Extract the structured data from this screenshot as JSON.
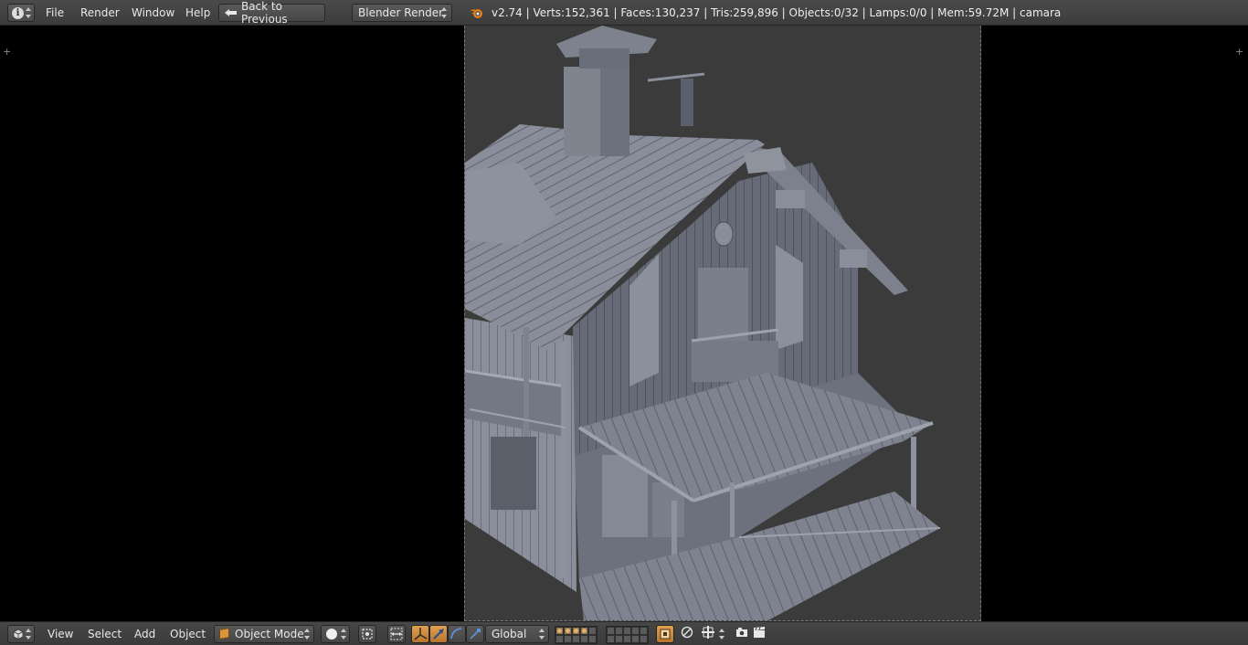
{
  "top_header": {
    "menu": [
      "File",
      "Render",
      "Window",
      "Help"
    ],
    "back_button_label": "Back to Previous",
    "render_engine": "Blender Render",
    "stats": "v2.74 | Verts:152,361 | Faces:130,237 | Tris:259,896 | Objects:0/32 | Lamps:0/0 | Mem:59.72M | camara"
  },
  "viewport_header": {
    "menu": [
      "View",
      "Select",
      "Add",
      "Object"
    ],
    "mode": "Object Mode",
    "transform_orientation": "Global"
  },
  "colors": {
    "header_bg": "#444444",
    "viewport_bg": "#000000",
    "camera_bg": "#3b3b3b",
    "model_gray": "#8a8e9a",
    "accent_orange": "#d9963c"
  }
}
